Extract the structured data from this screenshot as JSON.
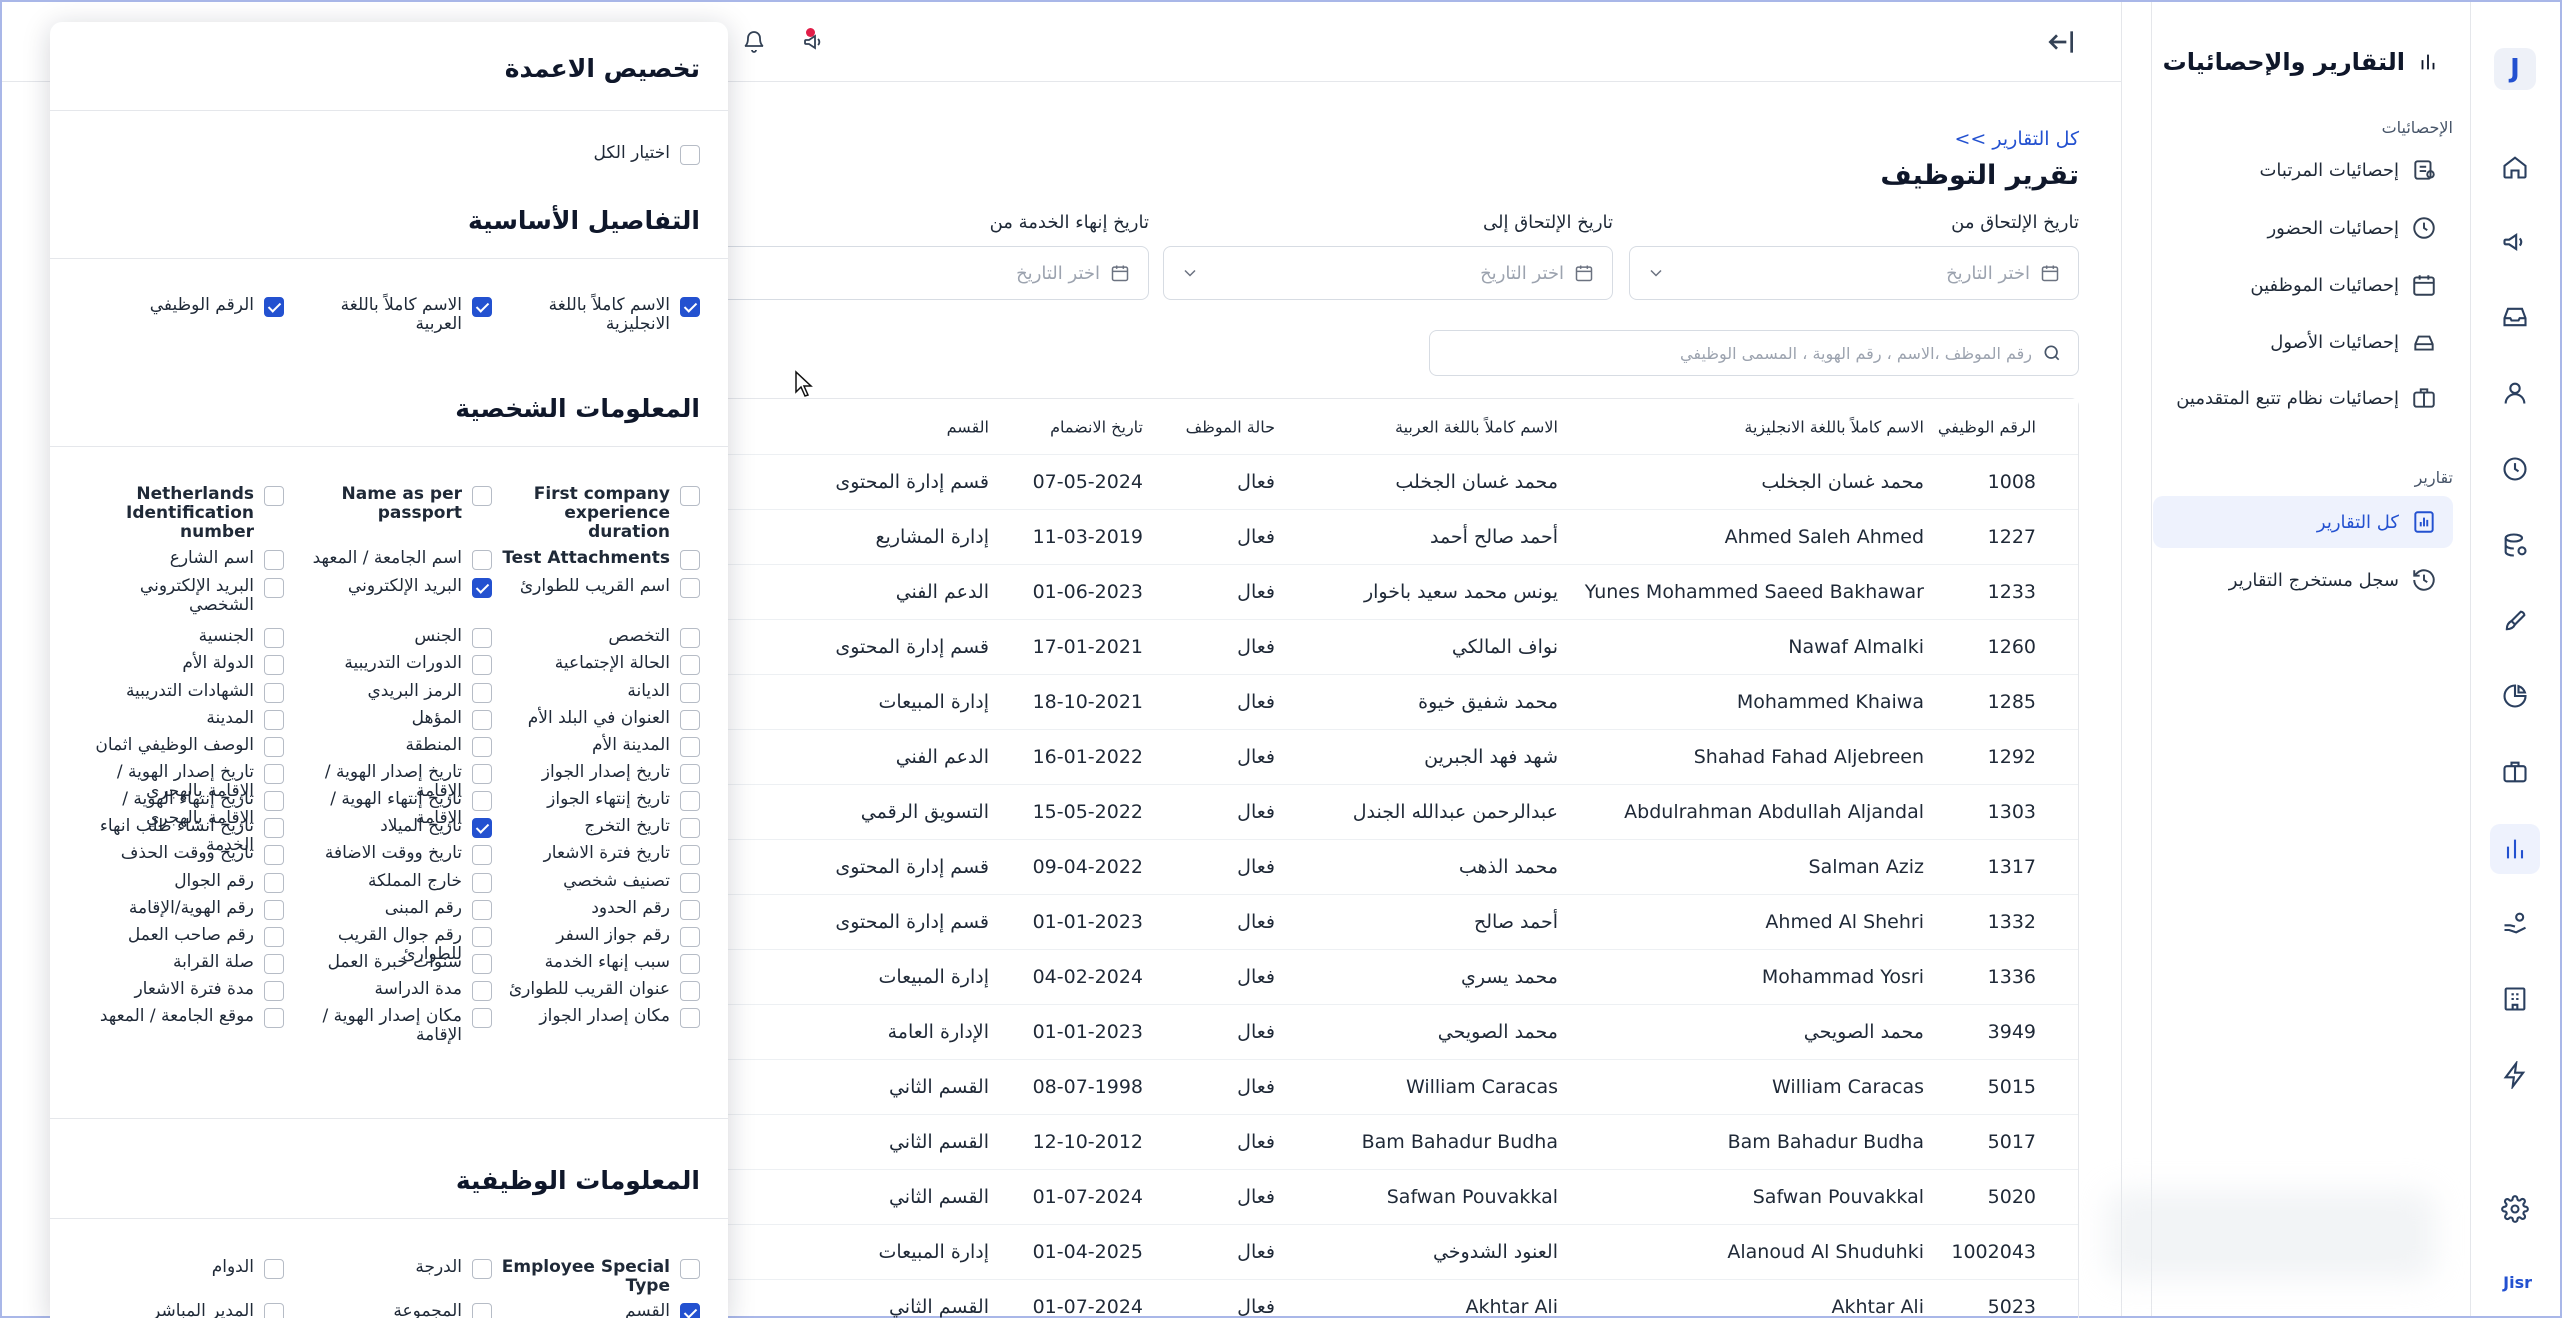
{
  "sidebar": {
    "title": "التقارير والإحصائيات",
    "stats_section": "الإحصائيات",
    "stats_items": [
      "إحصائيات المرتبات",
      "إحصائيات الحضور",
      "إحصائيات الموظفين",
      "إحصائيات الأصول",
      "إحصائيات نظام تتبع المتقدمين"
    ],
    "reports_section": "تقارير",
    "report_items": [
      "كل التقارير",
      "سجل مستخرج التقارير"
    ]
  },
  "rail": {
    "icons": [
      "home-icon",
      "megaphone-icon",
      "inbox-icon",
      "user-icon",
      "clock-icon",
      "payroll-icon",
      "rocket-icon",
      "pie-chart-icon",
      "briefcase-icon",
      "bar-chart-icon",
      "hand-coin-icon",
      "building-icon",
      "bolt-icon"
    ],
    "active": "bar-chart-icon",
    "brand": "Jisr"
  },
  "page": {
    "breadcrumb": "<< كل التقارير",
    "title": "تقرير التوظيف",
    "filter_join_from_label": "تاريخ الإلتحاق من",
    "filter_join_to_label": "تاريخ الإلتحاق إلى",
    "filter_end_from_label": "تاريخ إنهاء الخدمة من",
    "date_placeholder": "اختر التاريخ",
    "search_placeholder": "رقم الموظف ،الاسم ، رقم الهوية ، المسمى الوظيفي"
  },
  "table": {
    "headers": [
      "الرقم الوظيفي",
      "الاسم كاملاً باللغة الانجليزية",
      "الاسم كاملاً باللغة العربية",
      "حالة الموظف",
      "تاريخ الانضمام",
      "القسم"
    ],
    "rows": [
      [
        "1008",
        "محمد غسان الجخلب",
        "محمد غسان الجخلب",
        "فعال",
        "07-05-2024",
        "قسم إدارة المحتوى"
      ],
      [
        "1227",
        "Ahmed Saleh Ahmed",
        "أحمد صالح أحمد",
        "فعال",
        "11-03-2019",
        "إدارة المشاريع"
      ],
      [
        "1233",
        "Yunes Mohammed Saeed Bakhawar",
        "يونس محمد سعيد باخوار",
        "فعال",
        "01-06-2023",
        "الدعم الفني"
      ],
      [
        "1260",
        "Nawaf Almalki",
        "نواف المالكي",
        "فعال",
        "17-01-2021",
        "قسم إدارة المحتوى"
      ],
      [
        "1285",
        "Mohammed Khaiwa",
        "محمد شفيق خيوة",
        "فعال",
        "18-10-2021",
        "إدارة المبيعات"
      ],
      [
        "1292",
        "Shahad Fahad Aljebreen",
        "شهد فهد الجبرين",
        "فعال",
        "16-01-2022",
        "الدعم الفني"
      ],
      [
        "1303",
        "Abdulrahman Abdullah Aljandal",
        "عبدالرحمن عبدالله الجندل",
        "فعال",
        "15-05-2022",
        "التسويق الرقمي"
      ],
      [
        "1317",
        "Salman Aziz",
        "محمد الذهب",
        "فعال",
        "09-04-2022",
        "قسم إدارة المحتوى"
      ],
      [
        "1332",
        "Ahmed Al Shehri",
        "أحمد صالح",
        "فعال",
        "01-01-2023",
        "قسم إدارة المحتوى"
      ],
      [
        "1336",
        "Mohammad Yosri",
        "محمد يسري",
        "فعال",
        "04-02-2024",
        "إدارة المبيعات"
      ],
      [
        "3949",
        "محمد الصويحي",
        "محمد الصويحي",
        "فعال",
        "01-01-2023",
        "الإدارة العامة"
      ],
      [
        "5015",
        "William Caracas",
        "William Caracas",
        "فعال",
        "08-07-1998",
        "القسم الثاني"
      ],
      [
        "5017",
        "Bam Bahadur Budha",
        "Bam Bahadur Budha",
        "فعال",
        "12-10-2012",
        "القسم الثاني"
      ],
      [
        "5020",
        "Safwan Pouvakkal",
        "Safwan Pouvakkal",
        "فعال",
        "01-07-2024",
        "القسم الثاني"
      ],
      [
        "1002043",
        "Alanoud Al Shuduhki",
        "العنود الشدوخي",
        "فعال",
        "01-04-2025",
        "إدارة المبيعات"
      ],
      [
        "5023",
        "Akhtar Ali",
        "Akhtar Ali",
        "فعال",
        "01-07-2024",
        "القسم الثاني"
      ]
    ]
  },
  "columns_panel": {
    "title": "تخصيص الاعمدة",
    "select_all": "اختيار الكل",
    "basic_title": "التفاصيل الأساسية",
    "basic": [
      {
        "label": "الاسم كاملاً باللغة الانجليزية",
        "checked": true
      },
      {
        "label": "الاسم كاملاً باللغة العربية",
        "checked": true
      },
      {
        "label": "الرقم الوظيفي",
        "checked": true
      }
    ],
    "personal_title": "المعلومات الشخصية",
    "personal": [
      {
        "label": "First company experience duration",
        "checked": false
      },
      {
        "label": "Name as per passport",
        "checked": false
      },
      {
        "label": "Netherlands Identification number",
        "checked": false
      },
      {
        "label": "Test Attachments",
        "checked": false
      },
      {
        "label": "اسم الجامعة / المعهد",
        "checked": false
      },
      {
        "label": "اسم الشارع",
        "checked": false
      },
      {
        "label": "اسم القريب للطوارئ",
        "checked": false
      },
      {
        "label": "البريد الإلكتروني",
        "checked": true
      },
      {
        "label": "البريد الإلكتروني الشخصي",
        "checked": false
      },
      {
        "label": "التخصص",
        "checked": false
      },
      {
        "label": "الجنس",
        "checked": false
      },
      {
        "label": "الجنسية",
        "checked": false
      },
      {
        "label": "الحالة الإجتماعية",
        "checked": false
      },
      {
        "label": "الدورات التدريبية",
        "checked": false
      },
      {
        "label": "الدولة الأم",
        "checked": false
      },
      {
        "label": "الديانة",
        "checked": false
      },
      {
        "label": "الرمز البريدي",
        "checked": false
      },
      {
        "label": "الشهادات التدريبية",
        "checked": false
      },
      {
        "label": "العنوان في البلد الأم",
        "checked": false
      },
      {
        "label": "المؤهل",
        "checked": false
      },
      {
        "label": "المدينة",
        "checked": false
      },
      {
        "label": "المدينة الأم",
        "checked": false
      },
      {
        "label": "المنطقة",
        "checked": false
      },
      {
        "label": "الوصف الوظيفي اثمان",
        "checked": false
      },
      {
        "label": "تاريخ إصدار الجواز",
        "checked": false
      },
      {
        "label": "تاريخ إصدار الهوية / الإقامة",
        "checked": false
      },
      {
        "label": "تاريخ إصدار الهوية / الإقامة بالهجري",
        "checked": false
      },
      {
        "label": "تاريخ إنتهاء الجواز",
        "checked": false
      },
      {
        "label": "تاريخ إنتهاء الهوية / الإقامة",
        "checked": false
      },
      {
        "label": "تاريخ إنتهاء الهوية / الإقامة بالهجري",
        "checked": false
      },
      {
        "label": "تاريخ التخرج",
        "checked": false
      },
      {
        "label": "تاريخ الميلاد",
        "checked": true
      },
      {
        "label": "تاريخ انشاء طلب انهاء الخدمة",
        "checked": false
      },
      {
        "label": "تاريخ فترة الاشعار",
        "checked": false
      },
      {
        "label": "تاريخ ووقت الاضافة",
        "checked": false
      },
      {
        "label": "تاريخ ووقت الحذف",
        "checked": false
      },
      {
        "label": "تصنيف شخصي",
        "checked": false
      },
      {
        "label": "خارج المملكة",
        "checked": false
      },
      {
        "label": "رقم الجوال",
        "checked": false
      },
      {
        "label": "رقم الحدود",
        "checked": false
      },
      {
        "label": "رقم المبنى",
        "checked": false
      },
      {
        "label": "رقم الهوية/الإقامة",
        "checked": false
      },
      {
        "label": "رقم جواز السفر",
        "checked": false
      },
      {
        "label": "رقم جوال القريب للطوارئ",
        "checked": false
      },
      {
        "label": "رقم صاحب العمل",
        "checked": false
      },
      {
        "label": "سبب إنهاء الخدمة",
        "checked": false
      },
      {
        "label": "سنوات خبرة العمل",
        "checked": false
      },
      {
        "label": "صلة القرابة",
        "checked": false
      },
      {
        "label": "عنوان القريب للطوارئ",
        "checked": false
      },
      {
        "label": "مدة الدراسة",
        "checked": false
      },
      {
        "label": "مدة فترة الاشعار",
        "checked": false
      },
      {
        "label": "مكان إصدار الجواز",
        "checked": false
      },
      {
        "label": "مكان إصدار الهوية / الإقامة",
        "checked": false
      },
      {
        "label": "موقع الجامعة / المعهد",
        "checked": false
      }
    ],
    "job_title": "المعلومات الوظيفية",
    "job": [
      {
        "label": "Employee Special Type",
        "checked": false
      },
      {
        "label": "الدرجة",
        "checked": false
      },
      {
        "label": "الدوام",
        "checked": false
      },
      {
        "label": "القسم",
        "checked": true
      },
      {
        "label": "المجموعة",
        "checked": false
      },
      {
        "label": "المدير المباشر",
        "checked": false
      }
    ]
  }
}
